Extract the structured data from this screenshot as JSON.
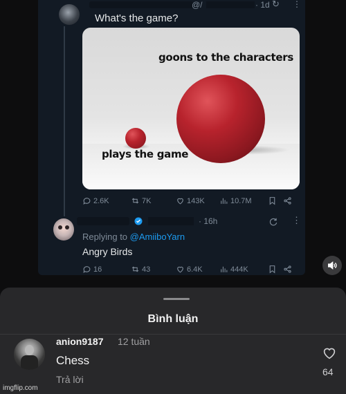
{
  "tweet1": {
    "handle_prefix": "@/",
    "time": "· 1d",
    "more": "⋮",
    "text": "What's the game?",
    "meme": {
      "label_big": "goons to the characters",
      "label_small": "plays the game"
    },
    "actions": {
      "replies": "2.6K",
      "reposts": "7K",
      "likes": "143K",
      "views": "10.7M"
    }
  },
  "tweet2": {
    "time": "· 16h",
    "more": "⋮",
    "replying_prefix": "Replying to",
    "replying_mention": "@AmiiboYarn",
    "text": "Angry Birds",
    "actions": {
      "replies": "16",
      "reposts": "43",
      "likes": "6.4K",
      "views": "444K"
    }
  },
  "comments_sheet": {
    "title": "Bình luận",
    "comment": {
      "username": "anion9187",
      "time": "12 tuần",
      "text": "Chess",
      "reply_label": "Trả lời",
      "like_count": "64"
    }
  },
  "watermark": "imgflip.com",
  "colors": {
    "accent_link": "#1d9bf0",
    "sheet_bg": "#28282a",
    "ball_red": "#b8232d"
  }
}
